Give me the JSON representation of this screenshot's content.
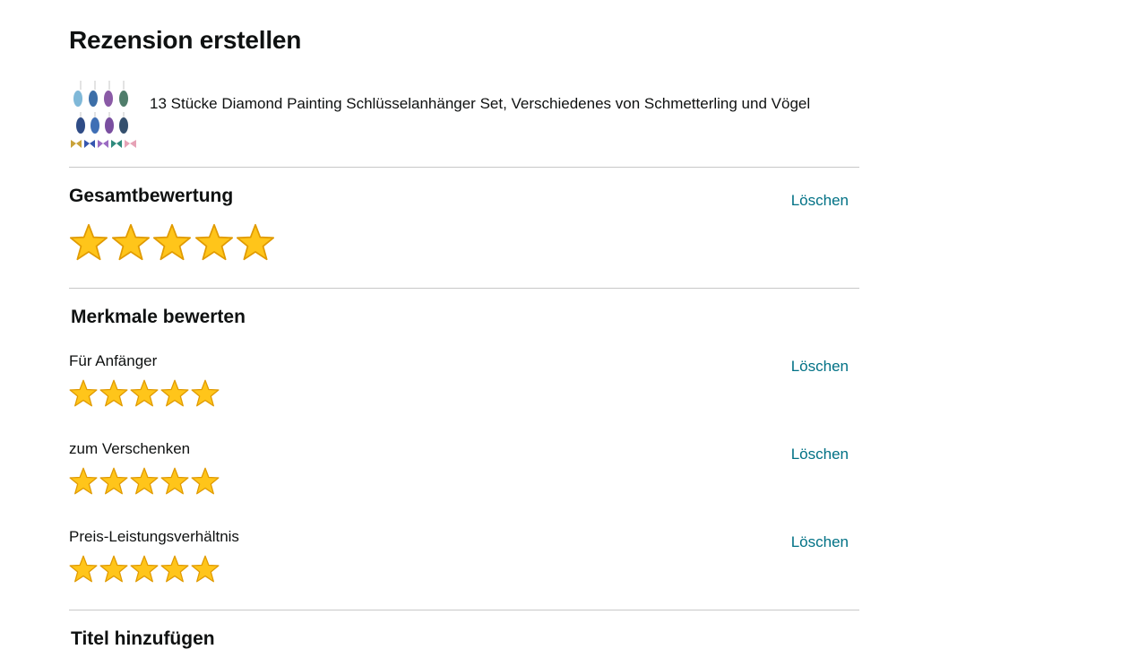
{
  "page": {
    "title": "Rezension erstellen"
  },
  "product": {
    "name": "13 Stücke Diamond Painting Schlüsselanhänger Set, Verschiedenes von Schmetterling und Vögel"
  },
  "overall": {
    "title": "Gesamtbewertung",
    "clear_label": "Löschen",
    "rating": 5,
    "max": 5
  },
  "features": {
    "title": "Merkmale bewerten",
    "items": [
      {
        "label": "Für Anfänger",
        "clear_label": "Löschen",
        "rating": 5,
        "max": 5
      },
      {
        "label": "zum Verschenken",
        "clear_label": "Löschen",
        "rating": 5,
        "max": 5
      },
      {
        "label": "Preis-Leistungsverhältnis",
        "clear_label": "Löschen",
        "rating": 5,
        "max": 5
      }
    ]
  },
  "title_section": {
    "title": "Titel hinzufügen"
  },
  "colors": {
    "star_fill": "#FFC51A",
    "star_stroke": "#E09A00",
    "link": "#007185",
    "divider": "#C8C8C8"
  },
  "icons": {
    "star": "star-icon"
  }
}
